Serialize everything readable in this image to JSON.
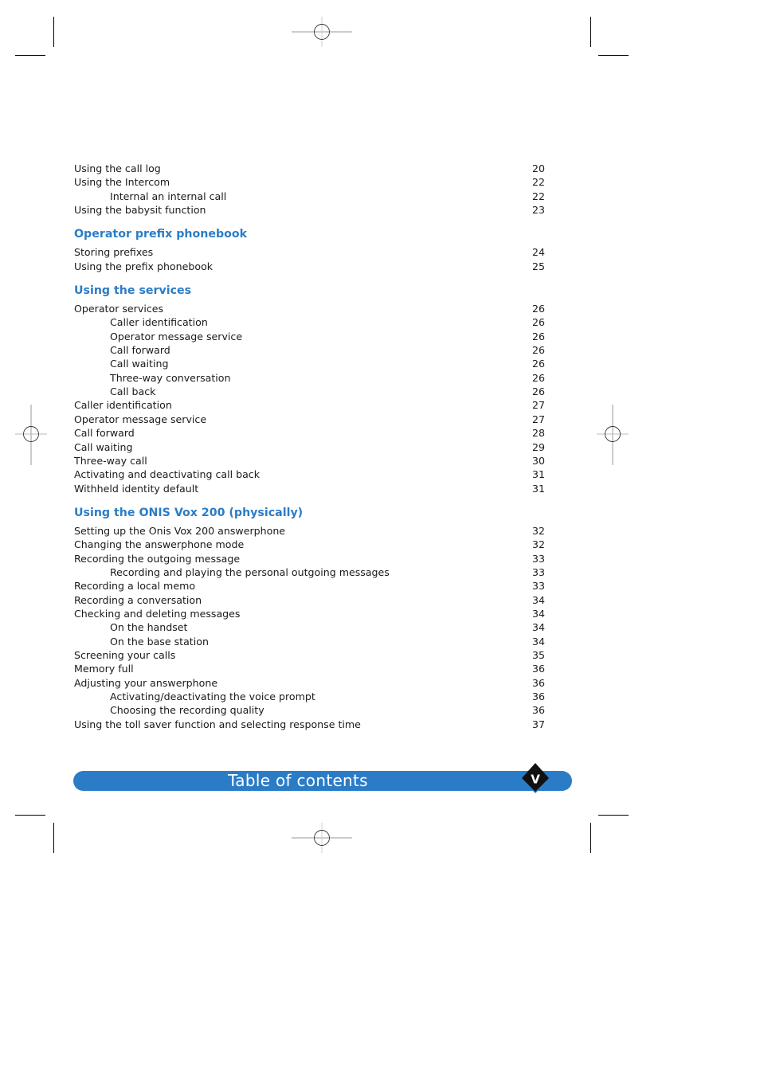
{
  "page": {
    "banner_title": "Table of contents",
    "page_marker": "V",
    "accent_color": "#2b7cc7"
  },
  "toc": {
    "intro_entries": [
      {
        "label": "Using the call log",
        "page": "20",
        "level": 1
      },
      {
        "label": "Using the Intercom",
        "page": "22",
        "level": 1
      },
      {
        "label": "Internal an internal call",
        "page": "22",
        "level": 2
      },
      {
        "label": "Using the babysit function",
        "page": "23",
        "level": 1
      }
    ],
    "sections": [
      {
        "title": "Operator prefix phonebook",
        "entries": [
          {
            "label": "Storing prefixes",
            "page": "24",
            "level": 1
          },
          {
            "label": "Using the prefix phonebook",
            "page": "25",
            "level": 1
          }
        ]
      },
      {
        "title": "Using the services",
        "entries": [
          {
            "label": "Operator services",
            "page": "26",
            "level": 1
          },
          {
            "label": "Caller identification",
            "page": "26",
            "level": 2
          },
          {
            "label": "Operator message service",
            "page": "26",
            "level": 2
          },
          {
            "label": "Call forward",
            "page": "26",
            "level": 2
          },
          {
            "label": "Call waiting",
            "page": "26",
            "level": 2
          },
          {
            "label": "Three-way conversation",
            "page": "26",
            "level": 2
          },
          {
            "label": "Call back",
            "page": "26",
            "level": 2
          },
          {
            "label": "Caller identification",
            "page": "27",
            "level": 1
          },
          {
            "label": "Operator message service",
            "page": "27",
            "level": 1
          },
          {
            "label": "Call forward",
            "page": "28",
            "level": 1
          },
          {
            "label": "Call waiting",
            "page": "29",
            "level": 1
          },
          {
            "label": "Three-way call",
            "page": "30",
            "level": 1
          },
          {
            "label": "Activating and deactivating call back",
            "page": "31",
            "level": 1
          },
          {
            "label": "Withheld identity default",
            "page": "31",
            "level": 1
          }
        ]
      },
      {
        "title": "Using the ONIS Vox 200 (physically)",
        "entries": [
          {
            "label": "Setting up the Onis Vox 200 answerphone",
            "page": "32",
            "level": 1
          },
          {
            "label": "Changing the answerphone mode",
            "page": "32",
            "level": 1
          },
          {
            "label": "Recording the outgoing message",
            "page": "33",
            "level": 1
          },
          {
            "label": "Recording and playing the personal outgoing messages",
            "page": "33",
            "level": 2
          },
          {
            "label": "Recording a local memo",
            "page": "33",
            "level": 1
          },
          {
            "label": "Recording a conversation",
            "page": "34",
            "level": 1
          },
          {
            "label": "Checking and deleting messages",
            "page": "34",
            "level": 1
          },
          {
            "label": "On the handset",
            "page": "34",
            "level": 2
          },
          {
            "label": "On the base station",
            "page": "34",
            "level": 2
          },
          {
            "label": "Screening your calls",
            "page": "35",
            "level": 1
          },
          {
            "label": "Memory full",
            "page": "36",
            "level": 1
          },
          {
            "label": "Adjusting your answerphone",
            "page": "36",
            "level": 1
          },
          {
            "label": "Activating/deactivating the voice prompt",
            "page": "36",
            "level": 2
          },
          {
            "label": "Choosing the recording quality",
            "page": "36",
            "level": 2
          },
          {
            "label": "Using the toll saver function and selecting response time",
            "page": "37",
            "level": 1
          }
        ]
      }
    ]
  }
}
